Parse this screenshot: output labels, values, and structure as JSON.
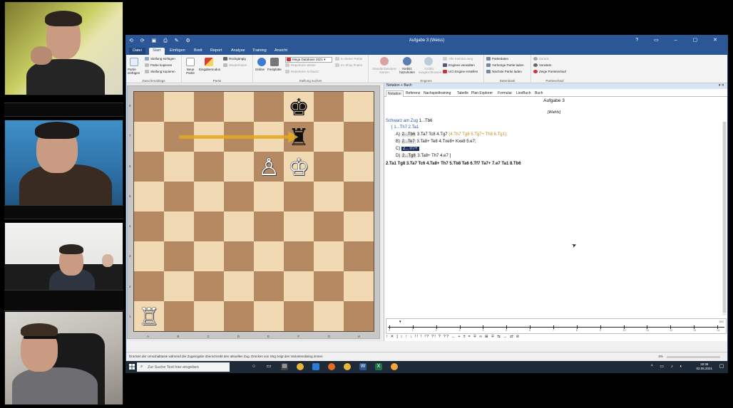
{
  "window": {
    "title": "Aufgabe 3 (Weiss)",
    "qat_icons": [
      "save-icon",
      "undo-icon",
      "redo-icon",
      "print-icon",
      "paste-icon",
      "settings-icon"
    ]
  },
  "ribbon_tabs": [
    "Datei",
    "Start",
    "Einfügen",
    "Brett",
    "Report",
    "Analyse",
    "Training",
    "Ansicht"
  ],
  "active_tab": "Start",
  "ribbon": {
    "zwischenablage": {
      "label": "Zwischenablage",
      "partie_einfuegen": "Partie einfügen",
      "stellung_einfuegen": "Stellung einfügen",
      "partie_kopieren": "Partie kopieren",
      "stellung_kopieren": "Stellung kopieren"
    },
    "partie": {
      "label": "Partie",
      "neue_partie": "Neue Partie",
      "eingabemodus": "Eingabemodus",
      "rueckgaengig": "Rückgängig",
      "wiederholen": "Wiederholen"
    },
    "stellung_suchen": {
      "label": "Stellung suchen",
      "online": "Online",
      "festplatte": "Festplatte",
      "database": "Mega Database 2021",
      "repertoire_weiss": "Repertoire Weiss",
      "repertoire_schwarz": "Repertoire Schwarz",
      "in_dieser_partie": "In dieser Partie",
      "im_shop_finden": "Im Shop finden"
    },
    "engines": {
      "label": "Engines",
      "standardanalyse": "Standardanalyse starten",
      "kiebitz": "Kiebitz hinzuholen",
      "kiebitz_ausgeschlossen": "Kiebitz ausgeschlossen",
      "alle_kiebitze": "Alle Kiebitze weg",
      "engines_verwalten": "Engines verwalten",
      "uci_engine": "UCI Engine erstellen"
    },
    "datenbank": {
      "label": "Datenbank",
      "partiedaten": "Partiedaten",
      "vorherige_partie": "Vorherige Partie laden",
      "naechste_partie": "Nächste Partie laden"
    },
    "partieverlauf": {
      "label": "Partieverlauf",
      "zurueck": "Zurück",
      "vorwaerts": "Vorwärts",
      "zeige_partieverlauf": "Zeige Partieverlauf"
    }
  },
  "board": {
    "ranks": [
      "8",
      "7",
      "6",
      "5",
      "4",
      "3",
      "2",
      "1"
    ],
    "files": [
      "A",
      "B",
      "C",
      "D",
      "E",
      "F",
      "G",
      "H"
    ],
    "pieces": [
      {
        "square": "f8",
        "glyph": "♚",
        "color": "black",
        "name": "black-king"
      },
      {
        "square": "f7",
        "glyph": "♜",
        "color": "black",
        "name": "black-rook"
      },
      {
        "square": "e6",
        "glyph": "♙",
        "color": "white",
        "name": "white-pawn"
      },
      {
        "square": "f6",
        "glyph": "♔",
        "color": "white",
        "name": "white-king"
      },
      {
        "square": "a1",
        "glyph": "♖",
        "color": "white",
        "name": "white-rook"
      }
    ],
    "arrow": {
      "from": "b7",
      "to": "f7",
      "color": "#e3a820"
    }
  },
  "notation": {
    "pane_title": "Notation + Buch",
    "tabs": [
      "Notation",
      "Referenz",
      "Nachspieltraining",
      "Tabelle",
      "Plan Explorer",
      "Formular",
      "LiveBuch",
      "Buch"
    ],
    "active_tab": "Notation",
    "heading": "Aufgabe 3",
    "subheading": "[Wahls]",
    "line1_prefix": "Schwarz am Zug",
    "line1_move": "1...Tb6",
    "line2": "[ 1...Th7  2.Ta1",
    "varA_label": "A)",
    "varA_box": "2...Tb6",
    "varA_rest": "3.Ta7  Tc8  4.Tg7",
    "varA_orange": "(4.Th7  Tg8  5.Tg7+  Th8  6.Tg1);",
    "varB_label": "B)",
    "varB_box": "2...Te7",
    "varB_rest": "3.Ta8+  Te8  4.Txe8+  Kxe8  5.e7;",
    "varC_label": "C)",
    "varC_box": "2...Tf7+",
    "varD_label": "D)",
    "varD_box": "2...Tg8",
    "varD_rest": "3.Ta8+  Th7  4.e7 ]",
    "mainline": "2.Ta1  Tg8  3.Ta7  Tc6  4.Ta8+  Th7  5.Tb8  Ta6  6.Tf7  Ta7+  7.e7  Ta1  8.Tb6"
  },
  "timeline": {
    "numbers": [
      "0",
      "1",
      "2",
      "3",
      "4",
      "5",
      "6",
      "7",
      "8",
      "9",
      "10",
      "11",
      "12",
      "13",
      "14"
    ],
    "end_label": "15/2"
  },
  "symbols": "↑  ✕  ]  ↕  ↑  ↓  !!  !  !?  ?!  ?  ??  ←  +  ±  =  ∓  ∞  ⊞  ∓  ⇆  →  ⇄  ⊘",
  "statusbar": {
    "text": "Drücken der Umschalttaste während der Zugeingabe überschreibt den aktuellen Zug. Drücken von Strg zeigt den Variantendialog immer.",
    "zoom": "0%"
  },
  "taskbar": {
    "search_placeholder": "Zur Suche Text hier eingeben",
    "time": "18:38",
    "date": "02.05.2021"
  },
  "colors": {
    "accent": "#2b5797",
    "light_square": "#f1d9b3",
    "dark_square": "#b58a63",
    "arrow": "#e3a820"
  }
}
